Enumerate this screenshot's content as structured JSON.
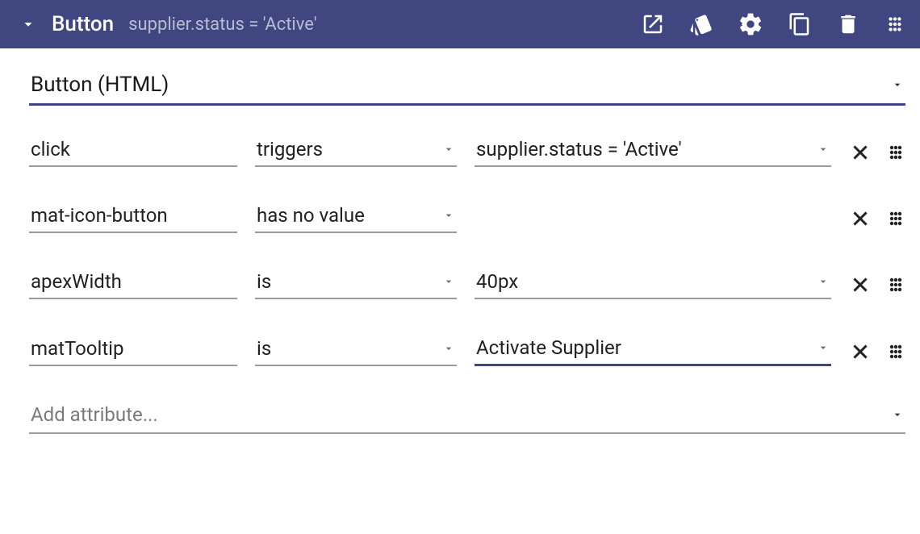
{
  "header": {
    "title": "Button",
    "subtitle": "supplier.status = 'Active'"
  },
  "elementType": "Button (HTML)",
  "rows": [
    {
      "name": "click",
      "operator": "triggers",
      "value": "supplier.status = 'Active'",
      "hasOperatorCaret": true,
      "hasValue": true,
      "valueCaret": true,
      "valueActive": false
    },
    {
      "name": "mat-icon-button",
      "operator": "has no value",
      "value": "",
      "hasOperatorCaret": true,
      "hasValue": false,
      "valueCaret": false,
      "valueActive": false
    },
    {
      "name": "apexWidth",
      "operator": "is",
      "value": "40px",
      "hasOperatorCaret": true,
      "hasValue": true,
      "valueCaret": true,
      "valueActive": false
    },
    {
      "name": "matTooltip",
      "operator": "is",
      "value": "Activate Supplier",
      "hasOperatorCaret": true,
      "hasValue": true,
      "valueCaret": true,
      "valueActive": true
    }
  ],
  "addPlaceholder": "Add attribute..."
}
